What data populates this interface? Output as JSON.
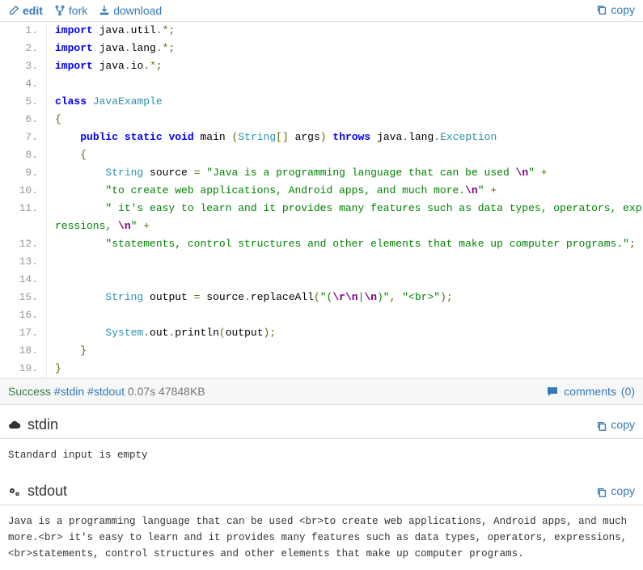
{
  "toolbar": {
    "edit_label": "edit",
    "fork_label": "fork",
    "download_label": "download",
    "copy_label": "copy"
  },
  "code": {
    "lines": [
      {
        "n": "1.",
        "tokens": [
          {
            "t": "import",
            "c": "kw"
          },
          {
            "t": " ",
            "c": ""
          },
          {
            "t": "java",
            "c": "ident"
          },
          {
            "t": ".",
            "c": "punc"
          },
          {
            "t": "util",
            "c": "ident"
          },
          {
            "t": ".*;",
            "c": "punc"
          }
        ]
      },
      {
        "n": "2.",
        "tokens": [
          {
            "t": "import",
            "c": "kw"
          },
          {
            "t": " ",
            "c": ""
          },
          {
            "t": "java",
            "c": "ident"
          },
          {
            "t": ".",
            "c": "punc"
          },
          {
            "t": "lang",
            "c": "ident"
          },
          {
            "t": ".*;",
            "c": "punc"
          }
        ]
      },
      {
        "n": "3.",
        "tokens": [
          {
            "t": "import",
            "c": "kw"
          },
          {
            "t": " ",
            "c": ""
          },
          {
            "t": "java",
            "c": "ident"
          },
          {
            "t": ".",
            "c": "punc"
          },
          {
            "t": "io",
            "c": "ident"
          },
          {
            "t": ".*;",
            "c": "punc"
          }
        ]
      },
      {
        "n": "4.",
        "tokens": []
      },
      {
        "n": "5.",
        "tokens": [
          {
            "t": "class",
            "c": "kw"
          },
          {
            "t": " ",
            "c": ""
          },
          {
            "t": "JavaExample",
            "c": "type"
          }
        ]
      },
      {
        "n": "6.",
        "tokens": [
          {
            "t": "{",
            "c": "brace"
          }
        ]
      },
      {
        "n": "7.",
        "indent": 1,
        "tokens": [
          {
            "t": "public",
            "c": "kw"
          },
          {
            "t": " ",
            "c": ""
          },
          {
            "t": "static",
            "c": "kw"
          },
          {
            "t": " ",
            "c": ""
          },
          {
            "t": "void",
            "c": "kw"
          },
          {
            "t": " ",
            "c": ""
          },
          {
            "t": "main",
            "c": "ident"
          },
          {
            "t": " ",
            "c": ""
          },
          {
            "t": "(",
            "c": "punc"
          },
          {
            "t": "String",
            "c": "type"
          },
          {
            "t": "[]",
            "c": "punc"
          },
          {
            "t": " ",
            "c": ""
          },
          {
            "t": "args",
            "c": "ident"
          },
          {
            "t": ")",
            "c": "punc"
          },
          {
            "t": " ",
            "c": ""
          },
          {
            "t": "throws",
            "c": "kw"
          },
          {
            "t": " ",
            "c": ""
          },
          {
            "t": "java",
            "c": "ident"
          },
          {
            "t": ".",
            "c": "punc"
          },
          {
            "t": "lang",
            "c": "ident"
          },
          {
            "t": ".",
            "c": "punc"
          },
          {
            "t": "Exception",
            "c": "type"
          }
        ]
      },
      {
        "n": "8.",
        "indent": 1,
        "tokens": [
          {
            "t": "{",
            "c": "brace"
          }
        ]
      },
      {
        "n": "9.",
        "indent": 2,
        "tokens": [
          {
            "t": "String",
            "c": "type"
          },
          {
            "t": " ",
            "c": ""
          },
          {
            "t": "source",
            "c": "ident"
          },
          {
            "t": " ",
            "c": ""
          },
          {
            "t": "=",
            "c": "punc"
          },
          {
            "t": " ",
            "c": ""
          },
          {
            "t": "\"Java is a programming language that can be used ",
            "c": "str"
          },
          {
            "t": "\\n",
            "c": "esc"
          },
          {
            "t": "\"",
            "c": "str"
          },
          {
            "t": " ",
            "c": ""
          },
          {
            "t": "+",
            "c": "punc"
          }
        ]
      },
      {
        "n": "10.",
        "indent": 2,
        "tokens": [
          {
            "t": "\"to create web applications, Android apps, and much more.",
            "c": "str"
          },
          {
            "t": "\\n",
            "c": "esc"
          },
          {
            "t": "\"",
            "c": "str"
          },
          {
            "t": " ",
            "c": ""
          },
          {
            "t": "+",
            "c": "punc"
          }
        ]
      },
      {
        "n": "11.",
        "indent": 2,
        "wrap": true,
        "tokens": [
          {
            "t": "\" it's easy to learn and it provides many features such as data types, operators, expressions, ",
            "c": "str"
          },
          {
            "t": "\\n",
            "c": "esc"
          },
          {
            "t": "\"",
            "c": "str"
          },
          {
            "t": " ",
            "c": ""
          },
          {
            "t": "+",
            "c": "punc"
          }
        ]
      },
      {
        "n": "12.",
        "indent": 2,
        "tokens": [
          {
            "t": "\"statements, control structures and other elements that make up computer programs.\"",
            "c": "str"
          },
          {
            "t": ";",
            "c": "punc"
          }
        ]
      },
      {
        "n": "13.",
        "tokens": []
      },
      {
        "n": "14.",
        "tokens": []
      },
      {
        "n": "15.",
        "indent": 2,
        "tokens": [
          {
            "t": "String",
            "c": "type"
          },
          {
            "t": " ",
            "c": ""
          },
          {
            "t": "output",
            "c": "ident"
          },
          {
            "t": " ",
            "c": ""
          },
          {
            "t": "=",
            "c": "punc"
          },
          {
            "t": " ",
            "c": ""
          },
          {
            "t": "source",
            "c": "ident"
          },
          {
            "t": ".",
            "c": "punc"
          },
          {
            "t": "replaceAll",
            "c": "ident"
          },
          {
            "t": "(",
            "c": "punc"
          },
          {
            "t": "\"(",
            "c": "str"
          },
          {
            "t": "\\r\\n",
            "c": "esc"
          },
          {
            "t": "|",
            "c": "str"
          },
          {
            "t": "\\n",
            "c": "esc"
          },
          {
            "t": ")\"",
            "c": "str"
          },
          {
            "t": ",",
            "c": "punc"
          },
          {
            "t": " ",
            "c": ""
          },
          {
            "t": "\"<br>\"",
            "c": "str"
          },
          {
            "t": ")",
            "c": "punc"
          },
          {
            "t": ";",
            "c": "punc"
          }
        ]
      },
      {
        "n": "16.",
        "tokens": []
      },
      {
        "n": "17.",
        "indent": 2,
        "tokens": [
          {
            "t": "System",
            "c": "type"
          },
          {
            "t": ".",
            "c": "punc"
          },
          {
            "t": "out",
            "c": "ident"
          },
          {
            "t": ".",
            "c": "punc"
          },
          {
            "t": "println",
            "c": "ident"
          },
          {
            "t": "(",
            "c": "punc"
          },
          {
            "t": "output",
            "c": "ident"
          },
          {
            "t": ")",
            "c": "punc"
          },
          {
            "t": ";",
            "c": "punc"
          }
        ]
      },
      {
        "n": "18.",
        "indent": 1,
        "tokens": [
          {
            "t": "}",
            "c": "brace"
          }
        ]
      },
      {
        "n": "19.",
        "tokens": [
          {
            "t": "}",
            "c": "brace"
          }
        ]
      }
    ]
  },
  "status": {
    "success_label": "Success",
    "stdin_hash": "#stdin",
    "stdout_hash": "#stdout",
    "time": "0.07s",
    "memory": "47848KB",
    "comments_label": "comments",
    "comments_count": "(0)"
  },
  "stdin": {
    "label": "stdin",
    "copy_label": "copy",
    "body": "Standard input is empty"
  },
  "stdout": {
    "label": "stdout",
    "copy_label": "copy",
    "body": "Java is a programming language that can be used <br>to create web applications, Android apps, and much more.<br> it's easy to learn and it provides many features such as data types, operators, expressions, <br>statements, control structures and other elements that make up computer programs."
  }
}
